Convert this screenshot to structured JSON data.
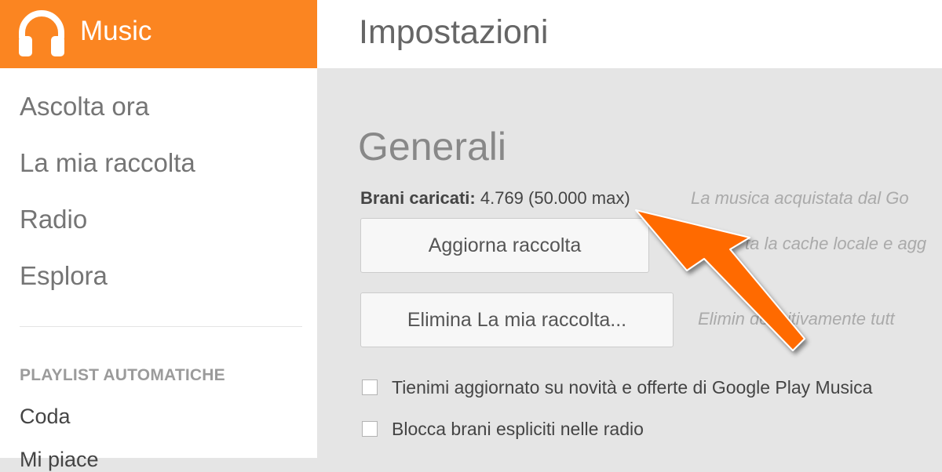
{
  "brand": {
    "name": "Music",
    "color": "#fb8521",
    "icon": "headphones-icon"
  },
  "nav": {
    "items": [
      "Ascolta ora",
      "La mia raccolta",
      "Radio",
      "Esplora"
    ]
  },
  "sidebar": {
    "section_label": "PLAYLIST AUTOMATICHE",
    "sub_items": [
      "Coda",
      "Mi piace"
    ]
  },
  "header": {
    "title": "Impostazioni"
  },
  "general": {
    "title": "Generali",
    "uploaded_label": "Brani caricati:",
    "uploaded_value": "4.769 (50.000 max)",
    "uploaded_hint": "La musica acquistata dal Go",
    "refresh_button": "Aggiorna raccolta",
    "refresh_hint": "ta la cache locale e agg",
    "delete_button": "Elimina La mia raccolta...",
    "delete_hint": "Elimin   definitivamente tutt",
    "checkbox_updates": "Tienimi aggiornato su novità e offerte di Google Play Musica",
    "checkbox_explicit": "Blocca brani espliciti nelle radio"
  },
  "annotation": {
    "arrow_color": "#ff6a00"
  }
}
